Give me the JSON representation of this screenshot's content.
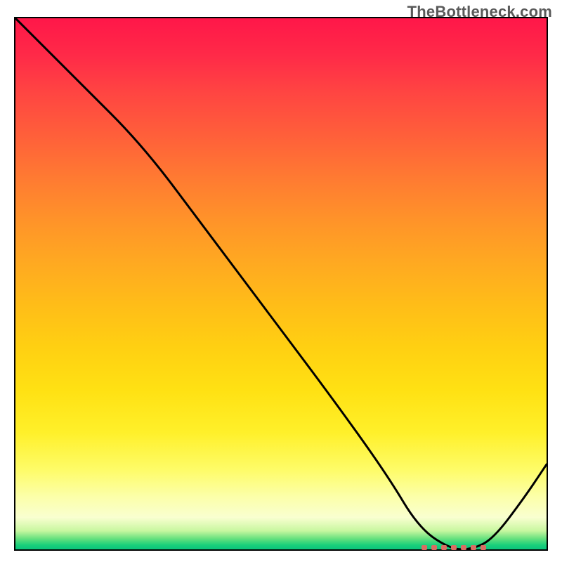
{
  "watermark": "TheBottleneck.com",
  "chart_data": {
    "type": "line",
    "title": "",
    "xlabel": "",
    "ylabel": "",
    "xlim": [
      0,
      100
    ],
    "ylim": [
      0,
      100
    ],
    "series": [
      {
        "name": "curve",
        "x": [
          0,
          12,
          24,
          36,
          48,
          60,
          70,
          76,
          82,
          86,
          90,
          96,
          100
        ],
        "y": [
          100,
          88,
          76,
          60,
          44,
          28,
          14,
          4,
          0,
          0,
          2,
          10,
          16
        ]
      }
    ],
    "flat_region": {
      "x_start": 76,
      "x_end": 88,
      "y": 0
    },
    "background_gradient": {
      "top": "#ff1749",
      "mid": "#ffe113",
      "bottom": "#0cc47c"
    }
  }
}
